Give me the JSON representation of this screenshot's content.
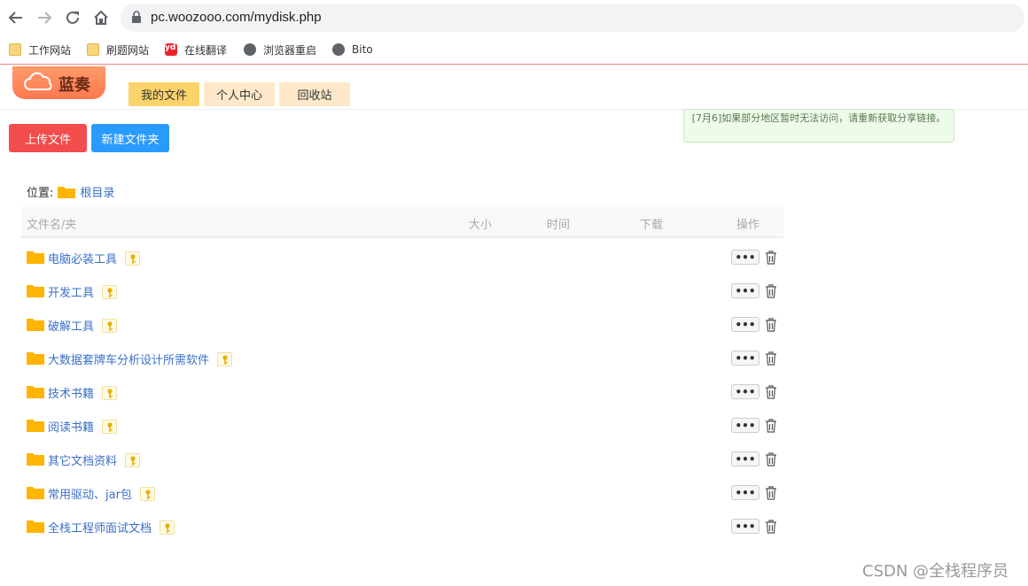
{
  "browser": {
    "url": "pc.woozooo.com/mydisk.php",
    "bookmarks": [
      {
        "label": "工作网站",
        "icon": "folder-icon"
      },
      {
        "label": "刷题网站",
        "icon": "folder-icon"
      },
      {
        "label": "在线翻译",
        "icon": "youdao-icon",
        "badge": "yd"
      },
      {
        "label": "浏览器重启",
        "icon": "globe-icon"
      },
      {
        "label": "Bito",
        "icon": "globe-icon"
      }
    ]
  },
  "header": {
    "logo_text": "蓝奏",
    "tabs": [
      {
        "label": "我的文件",
        "active": true
      },
      {
        "label": "个人中心",
        "active": false
      },
      {
        "label": "回收站",
        "active": false
      }
    ]
  },
  "toolbar": {
    "upload_label": "上传文件",
    "new_folder_label": "新建文件夹"
  },
  "notice": {
    "text": "[7月6]如果部分地区暂时无法访问，请重新获取分享链接。"
  },
  "location": {
    "label": "位置:",
    "root": "根目录"
  },
  "table": {
    "headers": {
      "name": "文件名/夹",
      "size": "大小",
      "time": "时间",
      "downloads": "下载",
      "actions": "操作"
    },
    "rows": [
      {
        "name": "电脑必装工具"
      },
      {
        "name": "开发工具"
      },
      {
        "name": "破解工具"
      },
      {
        "name": "大数据套牌车分析设计所需软件"
      },
      {
        "name": "技术书籍"
      },
      {
        "name": "阅读书籍"
      },
      {
        "name": "其它文档资料"
      },
      {
        "name": "常用驱动、jar包"
      },
      {
        "name": "全栈工程师面试文档"
      }
    ],
    "more_label": "•••"
  },
  "watermark": "CSDN @全栈程序员",
  "colors": {
    "folder": "#ffb400",
    "link": "#3b6fc9",
    "upload": "#f24c4c",
    "new_folder": "#289bff",
    "tab_active": "#fbd36b",
    "tab_inactive": "#fde9c9"
  }
}
